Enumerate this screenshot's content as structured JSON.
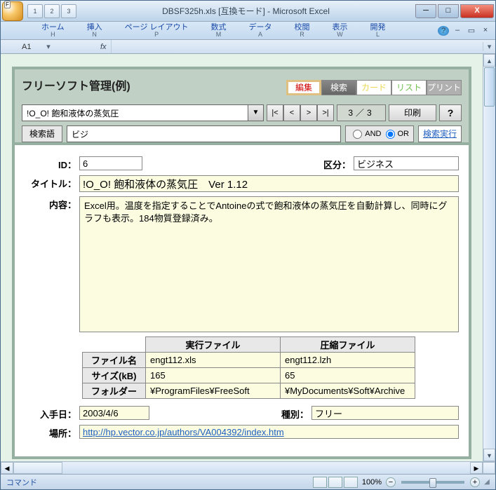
{
  "window": {
    "title": "DBSF325h.xls [互換モード] - Microsoft Excel",
    "qat": [
      "1",
      "2",
      "3"
    ]
  },
  "ribbon": {
    "tabs": [
      {
        "label": "ホーム",
        "key": "H"
      },
      {
        "label": "挿入",
        "key": "N"
      },
      {
        "label": "ページ レイアウト",
        "key": "P"
      },
      {
        "label": "数式",
        "key": "M"
      },
      {
        "label": "データ",
        "key": "A"
      },
      {
        "label": "校閲",
        "key": "R"
      },
      {
        "label": "表示",
        "key": "W"
      },
      {
        "label": "開発",
        "key": "L"
      }
    ]
  },
  "formula_bar": {
    "name_box": "A1",
    "fx": "fx"
  },
  "panel": {
    "title": "フリーソフト管理(例)",
    "modes": {
      "edit": "編集",
      "search": "検索",
      "card": "カード",
      "list": "リスト",
      "print": "プリント"
    },
    "dropdown_value": "!O_O! 飽和液体の蒸気圧",
    "nav": {
      "first": "|<",
      "prev": "<",
      "next": ">",
      "last": ">|"
    },
    "counter": "3／3",
    "print_btn": "印刷",
    "help_btn": "?",
    "search_label": "検索語",
    "search_value": "ビジ",
    "radio": {
      "and": "AND",
      "or": "OR",
      "selected": "OR"
    },
    "exec": "検索実行"
  },
  "form": {
    "id": {
      "label": "ID",
      "value": "6"
    },
    "kubun": {
      "label": "区分",
      "value": "ビジネス"
    },
    "title": {
      "label": "タイトル",
      "value": "!O_O! 飽和液体の蒸気圧　Ver 1.12"
    },
    "content": {
      "label": "内容",
      "value": "Excel用。温度を指定することでAntoineの式で飽和液体の蒸気圧を自動計算し、同時にグラフも表示。184物質登録済み。"
    },
    "table": {
      "headers": {
        "exec": "実行ファイル",
        "zip": "圧縮ファイル"
      },
      "rows": [
        {
          "head": "ファイル名",
          "exec": "engt112.xls",
          "zip": "engt112.lzh"
        },
        {
          "head": "サイズ(kB)",
          "exec": "165",
          "zip": "65"
        },
        {
          "head": "フォルダー",
          "exec": "¥ProgramFiles¥FreeSoft",
          "zip": "¥MyDocuments¥Soft¥Archive"
        }
      ]
    },
    "date": {
      "label": "入手日",
      "value": "2003/4/6"
    },
    "type": {
      "label": "種別",
      "value": "フリー"
    },
    "place": {
      "label": "場所",
      "value": "http://hp.vector.co.jp/authors/VA004392/index.htm"
    }
  },
  "status": {
    "left": "コマンド",
    "zoom": "100%"
  }
}
